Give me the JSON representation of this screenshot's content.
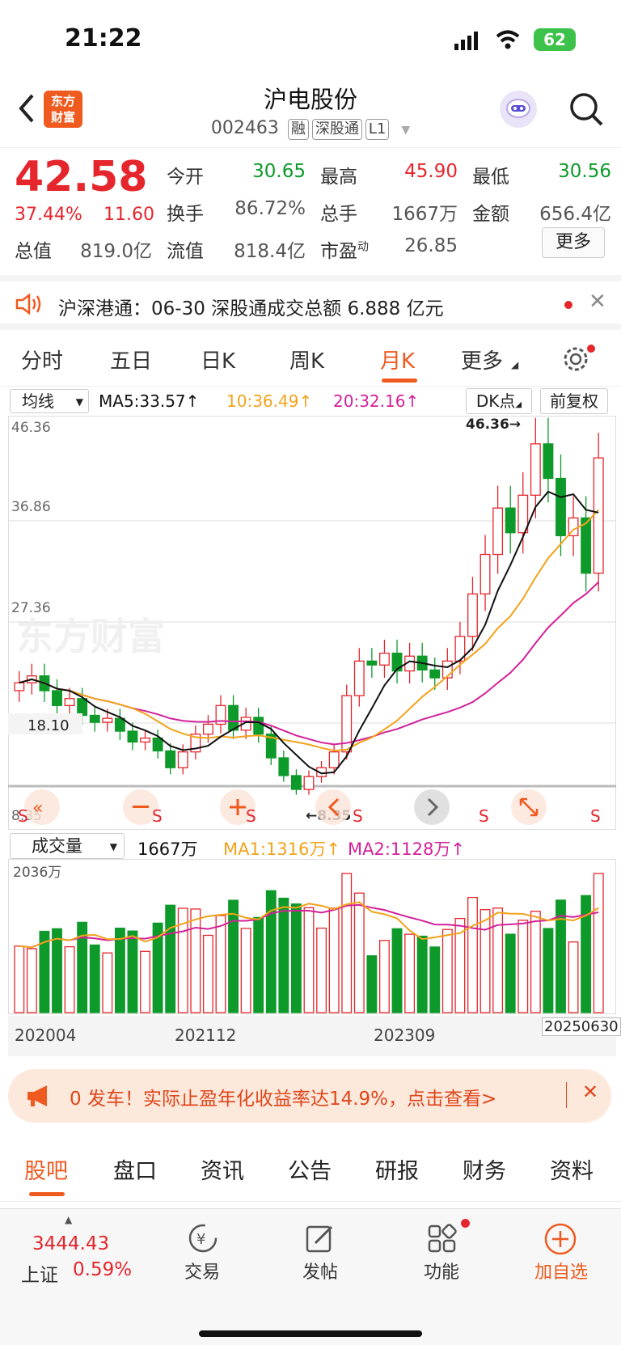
{
  "status": {
    "time": "21:22",
    "battery": "62"
  },
  "header": {
    "logo_line1": "东方",
    "logo_line2": "财富",
    "name": "沪电股份",
    "code": "002463",
    "tags": [
      "融",
      "深股通",
      "L1"
    ]
  },
  "quote": {
    "price": "42.58",
    "pct": "37.44%",
    "change": "11.60",
    "rows": [
      [
        {
          "l": "今开",
          "v": "30.65",
          "c": "green"
        },
        {
          "l": "最高",
          "v": "45.90",
          "c": "red"
        },
        {
          "l": "最低",
          "v": "30.56",
          "c": "green"
        }
      ],
      [
        {
          "l": "换手",
          "v": "86.72%",
          "c": "gray"
        },
        {
          "l": "总手",
          "v": "1667万",
          "c": "gray"
        },
        {
          "l": "金额",
          "v": "656.4亿",
          "c": "gray"
        }
      ]
    ],
    "row3": [
      {
        "l": "总值",
        "v": "819.0亿"
      },
      {
        "l": "流值",
        "v": "818.4亿"
      },
      {
        "l": "市盈",
        "sup": "动",
        "v": "26.85"
      }
    ],
    "more": "更多"
  },
  "notice": {
    "text": "沪深港通：06-30 深股通成交总额 6.888 亿元"
  },
  "tabs": [
    "分时",
    "五日",
    "日K",
    "周K",
    "月K",
    "更多"
  ],
  "ma": {
    "select": "均线",
    "ma5": "MA5:33.57↑",
    "ma10": "10:36.49↑",
    "ma20": "20:32.16↑",
    "dk": "DK点",
    "fq": "前复权"
  },
  "chart": {
    "y_labels": [
      "46.36",
      "36.86",
      "27.36",
      "18.10",
      "8.35"
    ],
    "max_label": "46.36→",
    "min_label": "←8.35",
    "watermark": "东方财富"
  },
  "chart_data": {
    "type": "candlestick",
    "ylim": [
      8.35,
      46.36
    ],
    "monthly_close_approx": [
      19.8,
      20.5,
      19.0,
      17.5,
      18.2,
      16.5,
      15.8,
      16.2,
      14.9,
      13.8,
      14.2,
      12.9,
      11.2,
      12.8,
      14.6,
      15.6,
      17.5,
      15.0,
      16.3,
      14.6,
      12.2,
      10.4,
      9.0,
      10.3,
      11.2,
      12.8,
      18.5,
      22.0,
      21.6,
      22.8,
      21.0,
      22.5,
      21.1,
      20.3,
      22.0,
      24.5,
      28.8,
      32.8,
      37.5,
      35.0,
      38.8,
      44.0,
      40.5,
      34.7,
      36.5,
      30.9,
      42.58
    ],
    "volume": {
      "title": "成交量",
      "value": "1667万",
      "ma1": "MA1:1316万↑",
      "ma2": "MA2:1128万↑",
      "max_label": "2036万"
    },
    "x_labels": [
      "202004",
      "202112",
      "202309",
      "20250630"
    ]
  },
  "ad": {
    "text": "0 发车！实际止盈年化收益率达14.9%，点击查看>"
  },
  "bottom_tabs": [
    "股吧",
    "盘口",
    "资讯",
    "公告",
    "研报",
    "财务",
    "资料"
  ],
  "footer": {
    "index_value": "3444.43",
    "index_name": "上证",
    "index_pct": "0.59%",
    "items": [
      "交易",
      "发帖",
      "功能",
      "加自选"
    ]
  }
}
